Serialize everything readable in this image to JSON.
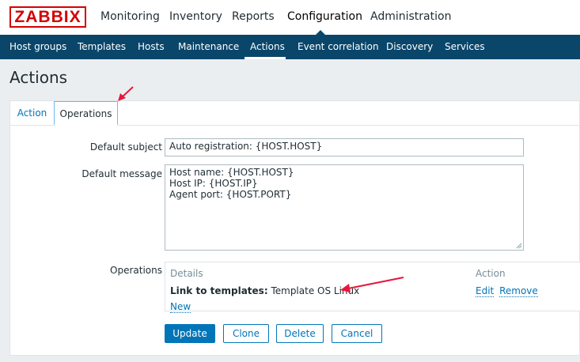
{
  "logo": "ZABBIX",
  "main_menu": [
    "Monitoring",
    "Inventory",
    "Reports",
    "Configuration",
    "Administration"
  ],
  "sub_menu": [
    "Host groups",
    "Templates",
    "Hosts",
    "Maintenance",
    "Actions",
    "Event correlation",
    "Discovery",
    "Services"
  ],
  "page_title": "Actions",
  "tabs": {
    "action": "Action",
    "operations": "Operations"
  },
  "form": {
    "default_subject_label": "Default subject",
    "default_subject_value": "Auto registration: {HOST.HOST}",
    "default_message_label": "Default message",
    "default_message_lines": [
      "Host name: {HOST.HOST}",
      "Host IP: {HOST.IP}",
      "Agent port: {HOST.PORT}"
    ],
    "operations_label": "Operations"
  },
  "operations": {
    "col_details": "Details",
    "col_action": "Action",
    "row_bold": "Link to templates:",
    "row_value": "Template OS Linux",
    "edit": "Edit",
    "remove": "Remove",
    "new": "New"
  },
  "buttons": {
    "update": "Update",
    "clone": "Clone",
    "delete": "Delete",
    "cancel": "Cancel"
  },
  "colors": {
    "brand_red": "#d40000",
    "nav_blue": "#0a466a",
    "link_blue": "#0275b8",
    "annotation_red": "#e8173c"
  }
}
